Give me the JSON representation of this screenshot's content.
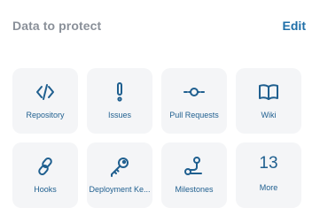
{
  "header": {
    "title": "Data to protect",
    "edit_label": "Edit"
  },
  "tiles": [
    {
      "label": "Repository",
      "icon": "code-icon"
    },
    {
      "label": "Issues",
      "icon": "exclamation-icon"
    },
    {
      "label": "Pull Requests",
      "icon": "pull-request-icon"
    },
    {
      "label": "Wiki",
      "icon": "book-icon"
    },
    {
      "label": "Hooks",
      "icon": "link-icon"
    },
    {
      "label": "Deployment Ke...",
      "icon": "key-icon"
    },
    {
      "label": "Milestones",
      "icon": "milestone-icon"
    }
  ],
  "more": {
    "count": "13",
    "label": "More"
  },
  "colors": {
    "accent": "#1f6fa8",
    "icon": "#1f5f8f",
    "tile_bg": "#f4f5f7",
    "title": "#8a9099"
  }
}
